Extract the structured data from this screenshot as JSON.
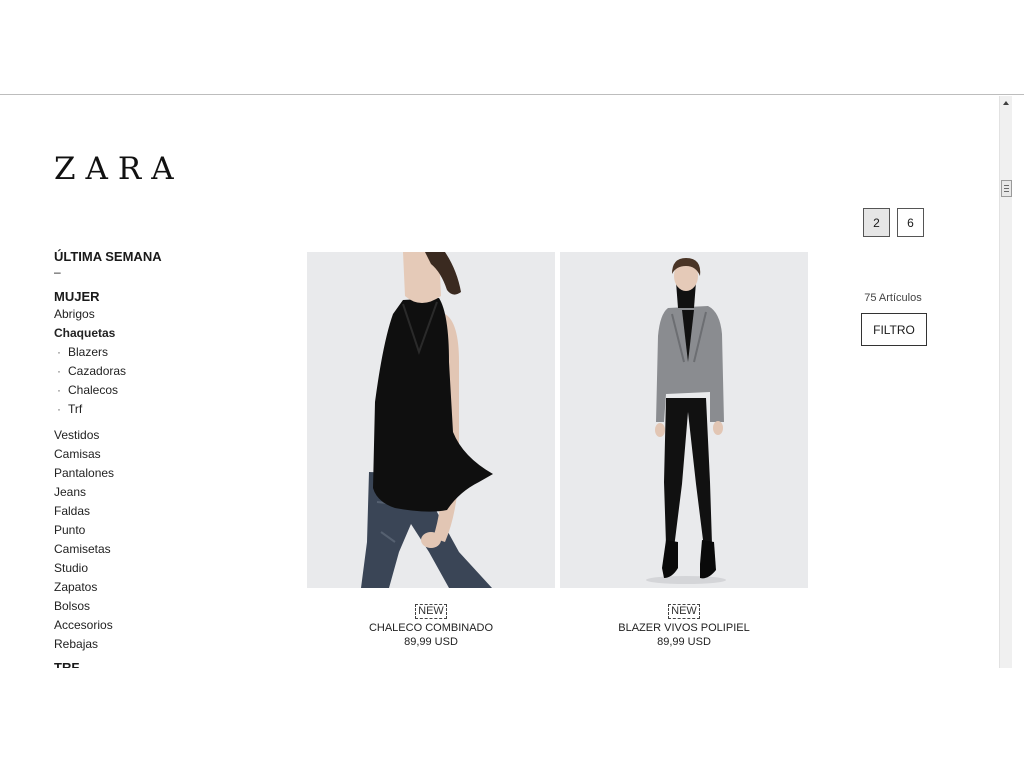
{
  "brand": {
    "logo_text": "ZARA"
  },
  "pager": [
    {
      "label": "2",
      "active": true
    },
    {
      "label": "6",
      "active": false
    }
  ],
  "listing": {
    "count_text": "75 Artículos",
    "filter_label": "FILTRO"
  },
  "sidebar": {
    "heading_week": "ÚLTIMA SEMANA",
    "dash": "–",
    "section_mujer": "MUJER",
    "items_top": [
      "Abrigos",
      "Chaquetas"
    ],
    "sub_items": [
      "Blazers",
      "Cazadoras",
      "Chalecos",
      "Trf"
    ],
    "items": [
      "Vestidos",
      "Camisas",
      "Pantalones",
      "Jeans",
      "Faldas",
      "Punto",
      "Camisetas",
      "Studio",
      "Zapatos",
      "Bolsos",
      "Accesorios",
      "Rebajas"
    ],
    "section_next": "TRF"
  },
  "products": [
    {
      "badge": "NEW",
      "name": "CHALECO COMBINADO",
      "price": "89,99 USD",
      "image_icon": "model-black-vest-photo"
    },
    {
      "badge": "NEW",
      "name": "BLAZER VIVOS POLIPIEL",
      "price": "89,99 USD",
      "image_icon": "model-grey-blazer-photo"
    }
  ],
  "colors": {
    "page_bg": "#ffffff",
    "photo_bg": "#e9eaec",
    "text": "#1a1a1a",
    "border": "#555555"
  }
}
